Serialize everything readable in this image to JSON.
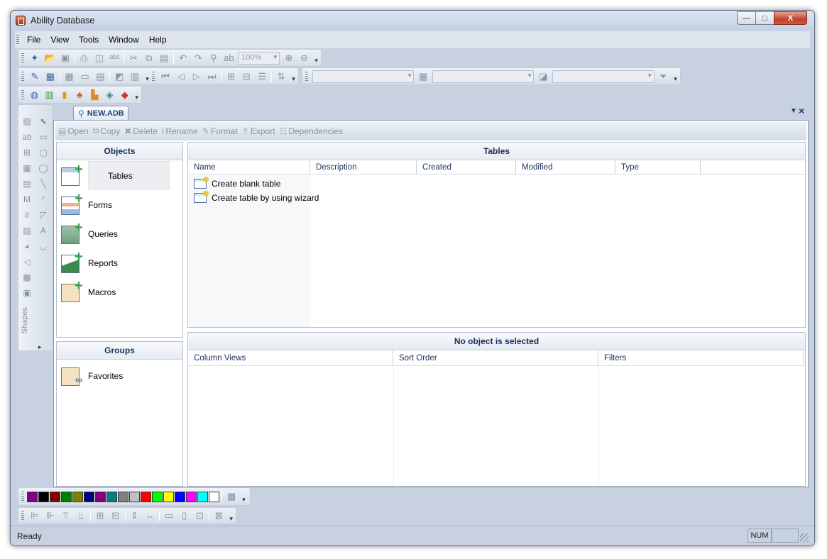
{
  "window": {
    "title": "Ability Database",
    "icon": "database-app-icon"
  },
  "titlebar_controls": {
    "minimize": "—",
    "maximize": "□",
    "close": "X"
  },
  "menu": [
    "File",
    "View",
    "Tools",
    "Window",
    "Help"
  ],
  "toolbar1": {
    "icons": [
      "new-icon",
      "open-icon",
      "save-icon",
      "print-icon",
      "print-preview-icon",
      "spelling-icon",
      "cut-icon",
      "copy-icon",
      "paste-icon",
      "undo-icon",
      "redo-icon",
      "find-icon",
      "replace-icon"
    ],
    "zoom_value": "100%",
    "zoom_icons": [
      "zoom-in-icon",
      "zoom-out-icon"
    ]
  },
  "toolbar2": {
    "icons": [
      "design-icon",
      "form-view-icon",
      "datasheet-icon",
      "form-icon",
      "report-icon",
      "label-icon",
      "query-icon",
      "sort-icon",
      "first-record-icon",
      "prev-record-icon",
      "next-record-icon",
      "last-record-icon",
      "insert-row-icon",
      "delete-row-icon",
      "indent-icon",
      "filter-icon"
    ]
  },
  "toolbar3": {
    "combo1": "",
    "combo2": "",
    "combo3": "",
    "filter_icon": "funnel-icon"
  },
  "toolbar4": {
    "icons": [
      "globe-icon",
      "book-icon",
      "script-icon",
      "people-icon",
      "chart-icon",
      "schema-icon",
      "diamond-icon"
    ]
  },
  "shapes_toolbar": {
    "label": "Shapes"
  },
  "document": {
    "tab_label": "NEW.ADB"
  },
  "actions": [
    {
      "label": "Open",
      "icon": "open-icon"
    },
    {
      "label": "Copy",
      "icon": "copy-icon"
    },
    {
      "label": "Delete",
      "icon": "delete-icon"
    },
    {
      "label": "Rename",
      "icon": "rename-icon"
    },
    {
      "label": "Format",
      "icon": "format-icon"
    },
    {
      "label": "Export",
      "icon": "export-icon"
    },
    {
      "label": "Dependencies",
      "icon": "dependencies-icon"
    }
  ],
  "objects": {
    "header": "Objects",
    "items": [
      {
        "label": "Tables",
        "icon": "table-icon",
        "selected": true
      },
      {
        "label": "Forms",
        "icon": "form-icon"
      },
      {
        "label": "Queries",
        "icon": "query-icon"
      },
      {
        "label": "Reports",
        "icon": "report-icon"
      },
      {
        "label": "Macros",
        "icon": "macro-icon"
      }
    ]
  },
  "groups": {
    "header": "Groups",
    "items": [
      {
        "label": "Favorites",
        "icon": "favorites-icon"
      }
    ]
  },
  "tables_panel": {
    "header": "Tables",
    "columns": [
      "Name",
      "Description",
      "Created",
      "Modified",
      "Type"
    ],
    "rows": [
      "Create blank table",
      "Create table by using wizard"
    ]
  },
  "properties_panel": {
    "header": "No object is selected",
    "columns": [
      "Column Views",
      "Sort Order",
      "Filters"
    ]
  },
  "palette": {
    "colors": [
      "#800080",
      "#000000",
      "#800000",
      "#008000",
      "#808000",
      "#000080",
      "#800080",
      "#008080",
      "#808080",
      "#c0c0c0",
      "#ff0000",
      "#00ff00",
      "#ffff00",
      "#0000ff",
      "#ff00ff",
      "#00ffff",
      "#ffffff"
    ]
  },
  "status": {
    "text": "Ready",
    "num": "NUM"
  }
}
